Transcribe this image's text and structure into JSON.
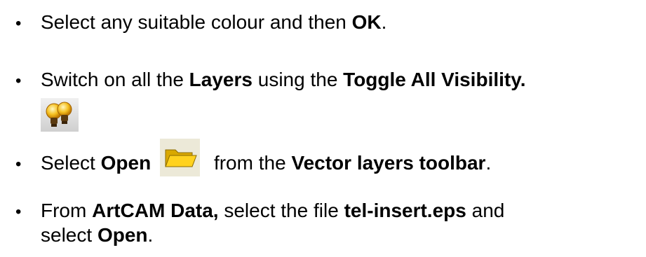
{
  "steps": [
    {
      "prefix": "Select any suitable colour and then ",
      "bold": "OK",
      "suffix": "."
    },
    {
      "prefix": "Switch on all the ",
      "bold1": "Layers",
      "middle": " using the ",
      "bold2": "Toggle All Visibility."
    },
    {
      "prefix": "Select ",
      "bold1": "Open",
      "middle": " from the ",
      "bold2": "Vector layers toolbar",
      "suffix": "."
    },
    {
      "prefix": "From ",
      "bold1": "ArtCAM Data,",
      "middle": " select the file ",
      "bold2": "tel-insert.eps",
      "suffix": " and",
      "line2_prefix": "select ",
      "line2_bold": "Open",
      "line2_suffix": "."
    }
  ],
  "bullet_char": "•",
  "icons": {
    "toggle_visibility": "light-bulbs-icon",
    "open": "open-folder-icon"
  }
}
